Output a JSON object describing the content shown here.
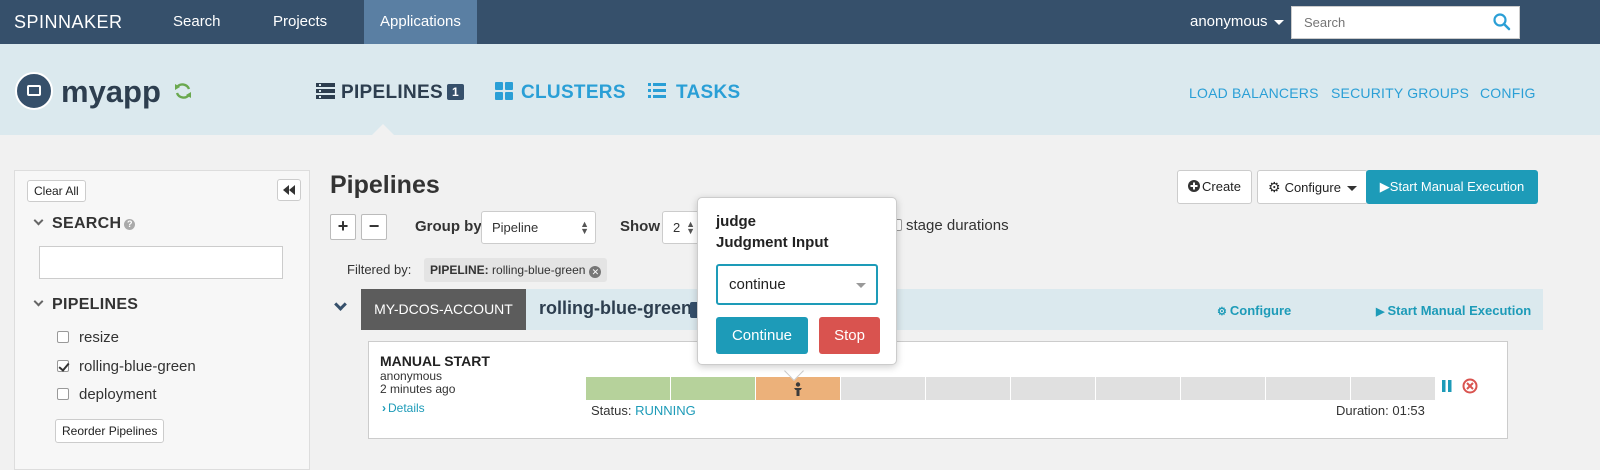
{
  "topnav": {
    "brand": "SPINNAKER",
    "links": [
      "Search",
      "Projects",
      "Applications"
    ],
    "user": "anonymous",
    "search_placeholder": "Search"
  },
  "app": {
    "name": "myapp",
    "tabs": [
      {
        "label": "PIPELINES",
        "badge": "1"
      },
      {
        "label": "CLUSTERS"
      },
      {
        "label": "TASKS"
      }
    ],
    "right_links": [
      "LOAD BALANCERS",
      "SECURITY GROUPS",
      "CONFIG"
    ]
  },
  "sidebar": {
    "clear_all": "Clear All",
    "search_title": "SEARCH",
    "help_glyph": "?",
    "pipelines_title": "PIPELINES",
    "pipelines": [
      {
        "name": "resize",
        "checked": false
      },
      {
        "name": "rolling-blue-green",
        "checked": true
      },
      {
        "name": "deployment",
        "checked": false
      }
    ],
    "reorder": "Reorder Pipelines"
  },
  "main": {
    "title": "Pipelines",
    "plus": "+",
    "minus": "−",
    "group_by_label": "Group by",
    "group_by_value": "Pipeline",
    "show_label": "Show",
    "show_value": "2",
    "stage_durations": "stage durations",
    "buttons": {
      "create": "Create",
      "configure": "Configure",
      "start_manual": "Start Manual Execution"
    },
    "filter_label": "Filtered by:",
    "filter_key": "PIPELINE:",
    "filter_value": "rolling-blue-green",
    "group": {
      "account": "MY-DCOS-ACCOUNT",
      "pipeline": "rolling-blue-green",
      "configure": "Configure",
      "start_manual": "Start Manual Execution"
    },
    "execution": {
      "trigger": "MANUAL START",
      "user": "anonymous",
      "time_ago": "2 minutes ago",
      "details": "Details",
      "status_label": "Status:",
      "status": "RUNNING",
      "duration": "Duration: 01:53",
      "stages": [
        "succeeded",
        "succeeded",
        "running",
        "not_started",
        "not_started",
        "not_started",
        "not_started",
        "not_started",
        "not_started",
        "not_started"
      ]
    }
  },
  "popover": {
    "title": "judge",
    "subtitle": "Judgment Input",
    "select_value": "continue",
    "continue": "Continue",
    "stop": "Stop"
  },
  "colors": {
    "nav": "#36506b",
    "accent": "#1d9bb8",
    "danger": "#d9534f",
    "stage_done": "#b6d29b",
    "stage_running": "#ecb17a",
    "stage_pending": "#e0e0e0"
  }
}
